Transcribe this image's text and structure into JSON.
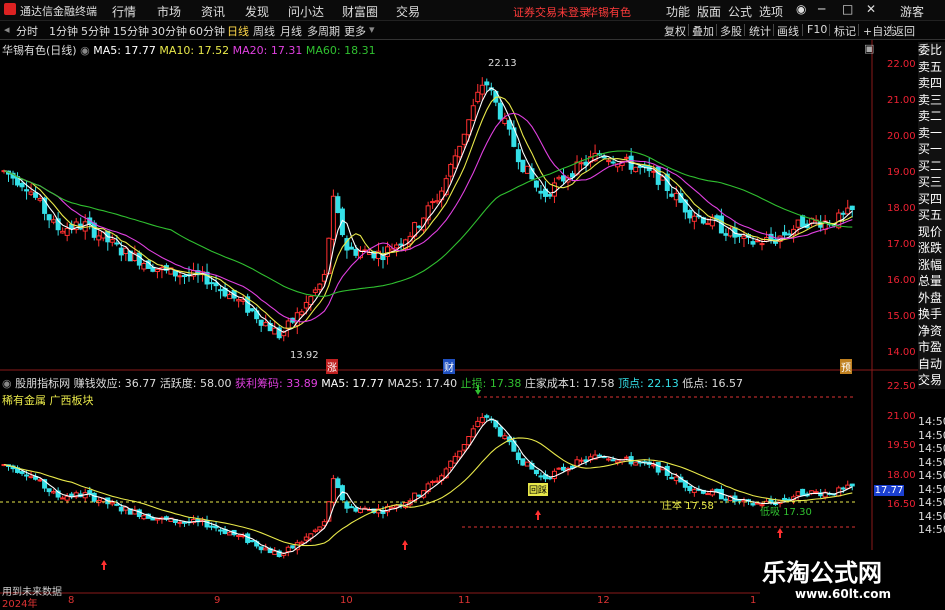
{
  "titlebar": {
    "app_name": "通达信金融终端",
    "menus": [
      "行情",
      "市场",
      "资讯",
      "发现",
      "问小达",
      "财富圈",
      "交易"
    ],
    "warning": "证券交易未登录",
    "stock_name": "华锡有色",
    "right_menus": [
      "功能",
      "版面",
      "公式",
      "选项"
    ],
    "guest": "游客"
  },
  "periodbar": {
    "periods": [
      "分时",
      "1分钟",
      "5分钟",
      "15分钟",
      "30分钟",
      "60分钟",
      "日线",
      "周线",
      "月线",
      "多周期",
      "更多"
    ],
    "active_period": "日线",
    "tools": [
      "复权",
      "叠加",
      "多股",
      "统计",
      "画线",
      "F10",
      "标记",
      "+自选",
      "返回"
    ]
  },
  "upper_legend": {
    "title": "华锡有色(日线)",
    "ma5": "MA5: 17.77",
    "ma10": "MA10: 17.52",
    "ma20": "MA20: 17.31",
    "ma60": "MA60: 18.31"
  },
  "upper_axis": [
    "22.00",
    "21.00",
    "20.00",
    "19.00",
    "18.00",
    "17.00",
    "16.00",
    "15.00",
    "14.00"
  ],
  "upper_annotations": {
    "high": "22.13",
    "low": "13.92",
    "marker_zhang": "涨",
    "marker_cai": "财",
    "marker_yu": "预"
  },
  "side_panel": [
    "委比",
    "卖五",
    "卖四",
    "卖三",
    "卖二",
    "卖一",
    "买一",
    "买二",
    "买三",
    "买四",
    "买五",
    "现价",
    "涨跌",
    "涨幅",
    "总量",
    "外盘",
    "换手",
    "净资",
    "市盈",
    "自动",
    "交易"
  ],
  "lower_legend": {
    "title": "股朋指标网",
    "profit": "赚钱效应: 36.77",
    "activity": "活跃度: 58.00",
    "chip": "获利筹码: 33.89",
    "ma5": "MA5: 17.77",
    "ma25": "MA25: 17.40",
    "stop": "止损: 17.38",
    "cost": "庄家成本1: 17.58",
    "top": "顶点: 22.13",
    "bottom": "低点: 16.57",
    "sector": "稀有金属 广西板块"
  },
  "lower_axis": [
    "22.50",
    "21.00",
    "19.50",
    "18.00",
    "16.50"
  ],
  "lower_axis_small": [
    "14:50",
    "14:50",
    "14:50",
    "14:50",
    "14:50",
    "14:50",
    "14:50",
    "14:50",
    "14:50"
  ],
  "current_price_tag": "17.77",
  "lower_annotations": {
    "cost_label": "庄本 17.58",
    "green_label": "低吸 17.30",
    "trap_label": "回踩"
  },
  "footer": {
    "note": "用到未来数据",
    "x_labels": [
      "2024年",
      "8",
      "9",
      "10",
      "11",
      "12",
      "1"
    ]
  },
  "watermark": {
    "line1": "乐淘公式网",
    "line2": "www.60lt.com"
  },
  "colors": {
    "up": "#ff3030",
    "down": "#35e0e8",
    "ma5": "#ffffff",
    "ma10": "#e8e84a",
    "ma20": "#e040e0",
    "ma60": "#30c030",
    "axis": "#cc2020"
  }
}
